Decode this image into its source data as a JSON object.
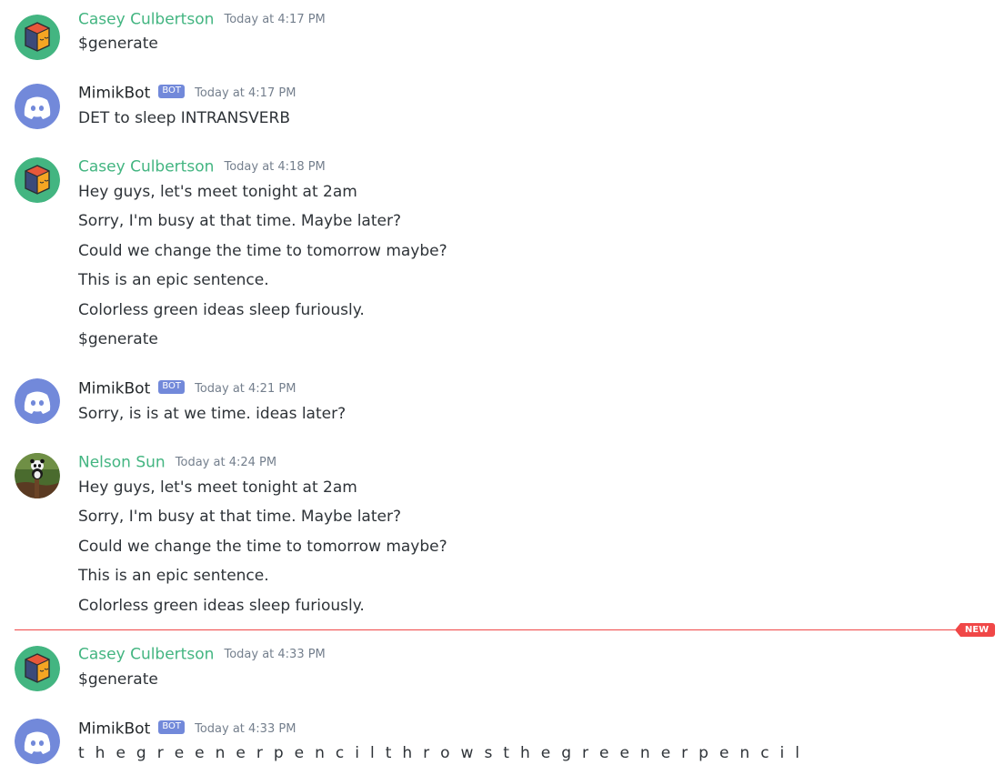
{
  "colors": {
    "user_name": "#43b581",
    "bot_name": "#23272a",
    "bot_tag": "#7289da",
    "timestamp": "#747f8d",
    "new_divider": "#f04747"
  },
  "divider": {
    "label": "NEW"
  },
  "messages": [
    {
      "author": "Casey Culbertson",
      "avatar": "box-avatar-icon",
      "timestamp": "Today at 4:17 PM",
      "lines": [
        "$generate"
      ]
    },
    {
      "author": "MimikBot",
      "bot_tag": "BOT",
      "avatar": "discord-logo-icon",
      "timestamp": "Today at 4:17 PM",
      "lines": [
        "DET to sleep INTRANSVERB"
      ]
    },
    {
      "author": "Casey Culbertson",
      "avatar": "box-avatar-icon",
      "timestamp": "Today at 4:18 PM",
      "lines": [
        "Hey guys, let's meet tonight at 2am",
        "Sorry, I'm busy at that time. Maybe later?",
        "Could we change the time to tomorrow maybe?",
        "This is an epic sentence.",
        "Colorless green ideas sleep furiously.",
        "$generate"
      ]
    },
    {
      "author": "MimikBot",
      "bot_tag": "BOT",
      "avatar": "discord-logo-icon",
      "timestamp": "Today at 4:21 PM",
      "lines": [
        "Sorry, is is at we time. ideas later?"
      ]
    },
    {
      "author": "Nelson Sun",
      "avatar": "panda-photo-avatar",
      "timestamp": "Today at 4:24 PM",
      "lines": [
        "Hey guys, let's meet tonight at 2am",
        "Sorry, I'm busy at that time. Maybe later?",
        "Could we change the time to tomorrow maybe?",
        "This is an epic sentence.",
        "Colorless green ideas sleep furiously."
      ]
    },
    {
      "author": "Casey Culbertson",
      "avatar": "box-avatar-icon",
      "timestamp": "Today at 4:33 PM",
      "lines": [
        "$generate"
      ]
    },
    {
      "author": "MimikBot",
      "bot_tag": "BOT",
      "avatar": "discord-logo-icon",
      "timestamp": "Today at 4:33 PM",
      "lines": [
        "t h e g r e e n e r p e n c i l t h r o w s t h e g r e e n e r p e n c i l"
      ]
    }
  ]
}
